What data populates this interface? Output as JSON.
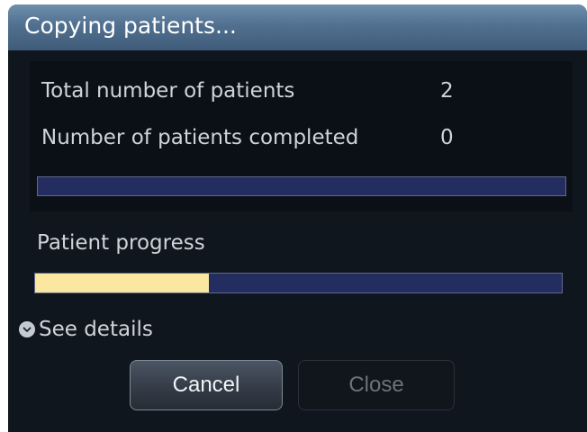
{
  "dialog": {
    "title": "Copying patients..."
  },
  "summary": {
    "total_label": "Total number of patients",
    "total_value": "2",
    "completed_label": "Number of patients completed",
    "completed_value": "0",
    "overall_progress_fraction": 0.0
  },
  "patient": {
    "progress_label": "Patient progress",
    "progress_fraction": 0.33
  },
  "details": {
    "label": "See details",
    "icon": "chevron-down-icon"
  },
  "buttons": {
    "cancel_label": "Cancel",
    "close_label": "Close",
    "close_enabled": false
  },
  "colors": {
    "title_bar": "#51708f",
    "dialog_background": "#10161e",
    "progress_track": "#232d60",
    "progress_fill": "#fbe7a0",
    "text": "#cfd4da"
  }
}
